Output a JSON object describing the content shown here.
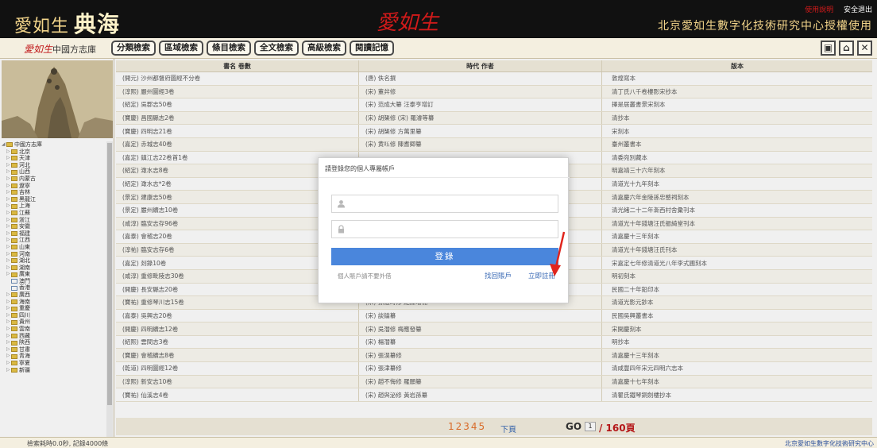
{
  "header": {
    "logo_text": "愛如生",
    "logo_big": "典海",
    "center_logo": "愛如生",
    "help": "使用說明",
    "exit": "安全退出",
    "license": "北京愛如生數字化技術研究中心授權使用"
  },
  "toolbar": {
    "lib_logo_red": "愛如生",
    "lib_logo_text": "中國方志庫",
    "tabs": [
      "分類檢索",
      "區域檢索",
      "條目檢索",
      "全文檢索",
      "高級檢索",
      "閱讀記憶"
    ],
    "win_icons": [
      "window-icon",
      "home-icon",
      "close-icon"
    ]
  },
  "tree": {
    "root": "中國方志庫",
    "items": [
      "北京",
      "天津",
      "河北",
      "山西",
      "内蒙古",
      "遼寧",
      "吉林",
      "黑龍江",
      "上海",
      "江蘇",
      "浙江",
      "安徽",
      "福建",
      "江西",
      "山東",
      "河南",
      "湖北",
      "湖南",
      "廣東",
      "澳門",
      "香港",
      "廣西",
      "海南",
      "重慶",
      "四川",
      "貴州",
      "雲南",
      "西藏",
      "陝西",
      "甘肅",
      "青海",
      "寧夏",
      "新疆"
    ],
    "leaf_items": [
      "澳門",
      "香港"
    ]
  },
  "grid": {
    "headers": [
      "書名 卷數",
      "時代 作者",
      "版本"
    ],
    "rows": [
      [
        "(開元) 沙州都督府圖經不分卷",
        "(唐) 佚名撰",
        "敦煌寫本"
      ],
      [
        "(淳熙) 嚴州圖經3卷",
        "(宋) 董弅修",
        "清丁氏八千卷樓影宋抄本"
      ],
      [
        "(紹定) 吳郡志50卷",
        "(宋) 范成大纂 汪泰亨增訂",
        "擇是居叢書景宋刻本"
      ],
      [
        "(寶慶) 昌國縣志2卷",
        "(宋) 胡榘修 (宋) 羅濬等纂",
        "清抄本"
      ],
      [
        "(寶慶) 四明志21卷",
        "(宋) 胡榘修 方萬里纂",
        "宋刻本"
      ],
      [
        "(嘉定) 赤城志40卷",
        "(宋) 黄𥄬修 陳耆卿纂",
        "臺州叢書本"
      ],
      [
        "(嘉定) 鎮江志22卷首1卷",
        "",
        "清委宛別藏本"
      ],
      [
        "(紹定) 澉水志8卷",
        "",
        "明嘉靖三十六年刻本"
      ],
      [
        "(紹定) 澉水志*2卷",
        "",
        "清道光十九年刻本"
      ],
      [
        "(景定) 建康志50卷",
        "",
        "清嘉慶六年金陵孫忠愍祠刻本"
      ],
      [
        "(景定) 嚴州續志10卷",
        "",
        "清光緒二十二年漸西村舍彙刊本"
      ],
      [
        "(咸淳) 臨安志存96卷",
        "",
        "清道光十年錢塘汪氏振綺堂刊本"
      ],
      [
        "(嘉泰) 會稽志20卷",
        "",
        "清嘉慶十三年刻本"
      ],
      [
        "(淳祐) 臨安志存6卷",
        "",
        "清道光十年錢塘汪氏刊本"
      ],
      [
        "(嘉定) 剡錄10卷",
        "",
        "宋嘉定七年修清道光八年李式圃刻本"
      ],
      [
        "(咸淳) 重修毗陵志30卷",
        "",
        "明初刻本"
      ],
      [
        "(開慶) 長安縣志20卷",
        "",
        "民國二十年鉛印本"
      ],
      [
        "(寶祐) 重修琴川志15卷",
        "(宋) 孫應時修 鮑廉增補",
        "清道光影元鈔本"
      ],
      [
        "(嘉泰) 吳興志20卷",
        "(宋) 談鑰纂",
        "民國吳興叢書本"
      ],
      [
        "(開慶) 四明續志12卷",
        "(宋) 吳潛修 梅應發纂",
        "宋開慶刻本"
      ],
      [
        "(紹熙) 雲間志3卷",
        "(宋) 楊潛纂",
        "明抄本"
      ],
      [
        "(寶慶) 會稽續志8卷",
        "(宋) 張淏纂修",
        "清嘉慶十三年刻本"
      ],
      [
        "(乾道) 四明圖經12卷",
        "(宋) 張津纂修",
        "清咸豐四年宋元四明六志本"
      ],
      [
        "(淳熙) 新安志10卷",
        "(宋) 趙不悔修 羅願纂",
        "清嘉慶十七年刻本"
      ],
      [
        "(寶祐) 仙溪志4卷",
        "(宋) 趙與泌修 黃岩孫纂",
        "清瞿氏鐵琴銅劍樓抄本"
      ]
    ]
  },
  "pager": {
    "pages": "12345",
    "next": "下頁",
    "go": "GO",
    "go_value": "1",
    "total": "/ 160頁"
  },
  "status": {
    "left": "檢索耗時0.0秒, 記錄4000條",
    "right": "北京愛如生數字化技術研究中心"
  },
  "dialog": {
    "title": "請登錄您的個人專屬帳戶",
    "username_placeholder": "",
    "password_placeholder": "",
    "login": "登錄",
    "hint": "個人賬戶請不要外借",
    "recover": "找回賬戶",
    "register": "立即註冊"
  },
  "colors": {
    "accent": "#4a86dc",
    "brand_red": "#c0181a",
    "toolbar_bg": "#f4efe0"
  }
}
